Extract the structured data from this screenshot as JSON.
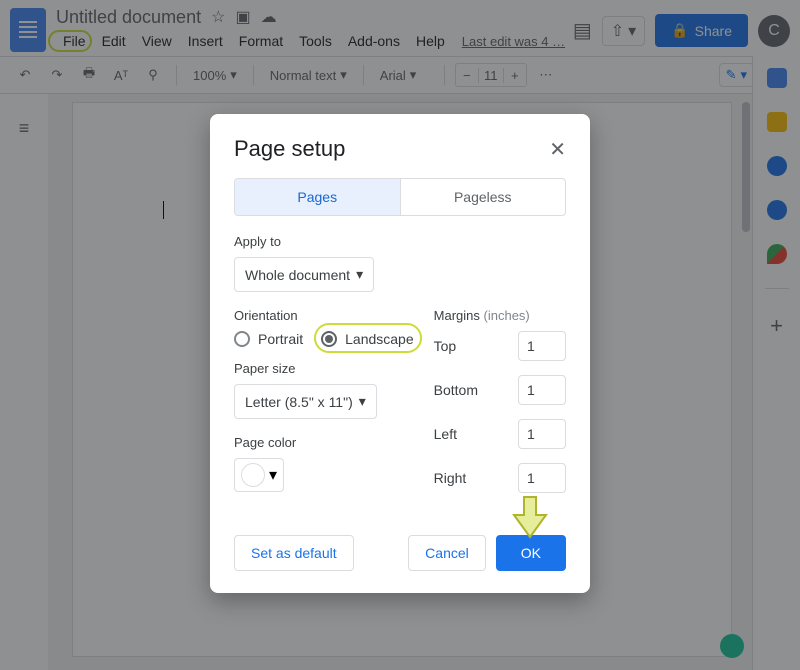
{
  "doc": {
    "title": "Untitled document",
    "last_edit": "Last edit was 4 …"
  },
  "menubar": [
    "File",
    "Edit",
    "View",
    "Insert",
    "Format",
    "Tools",
    "Add-ons",
    "Help"
  ],
  "topright": {
    "share": "Share",
    "avatar_letter": "C"
  },
  "toolbar": {
    "zoom": "100%",
    "style": "Normal text",
    "font": "Arial",
    "font_size": "11"
  },
  "modal": {
    "title": "Page setup",
    "tabs": {
      "pages": "Pages",
      "pageless": "Pageless"
    },
    "apply_to_label": "Apply to",
    "apply_to_value": "Whole document",
    "orientation_label": "Orientation",
    "orientation": {
      "portrait": "Portrait",
      "landscape": "Landscape",
      "selected": "landscape"
    },
    "paper_size_label": "Paper size",
    "paper_size_value": "Letter (8.5\" x 11\")",
    "page_color_label": "Page color",
    "margins_label": "Margins",
    "margins_hint": "(inches)",
    "margins": {
      "top": {
        "label": "Top",
        "value": "1"
      },
      "bottom": {
        "label": "Bottom",
        "value": "1"
      },
      "left": {
        "label": "Left",
        "value": "1"
      },
      "right": {
        "label": "Right",
        "value": "1"
      }
    },
    "buttons": {
      "set_default": "Set as default",
      "cancel": "Cancel",
      "ok": "OK"
    }
  }
}
